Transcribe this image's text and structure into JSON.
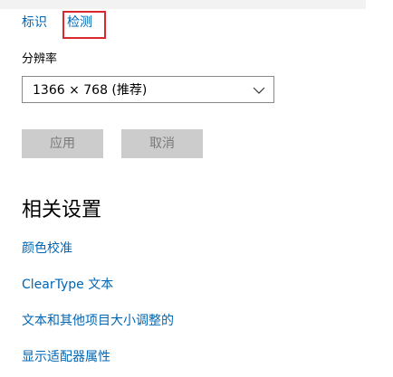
{
  "nav": {
    "identify_label": "标识",
    "detect_label": "检测"
  },
  "resolution": {
    "label": "分辨率",
    "selected": "1366 × 768 (推荐)"
  },
  "buttons": {
    "apply": "应用",
    "cancel": "取消"
  },
  "related": {
    "title": "相关设置",
    "links": [
      "颜色校准",
      "ClearType 文本",
      "文本和其他项目大小调整的",
      "显示适配器属性"
    ]
  },
  "colors": {
    "link": "#0066b4",
    "highlight": "#d9282e",
    "disabled_button_bg": "#cccccc",
    "disabled_button_text": "#7a7a7a"
  }
}
